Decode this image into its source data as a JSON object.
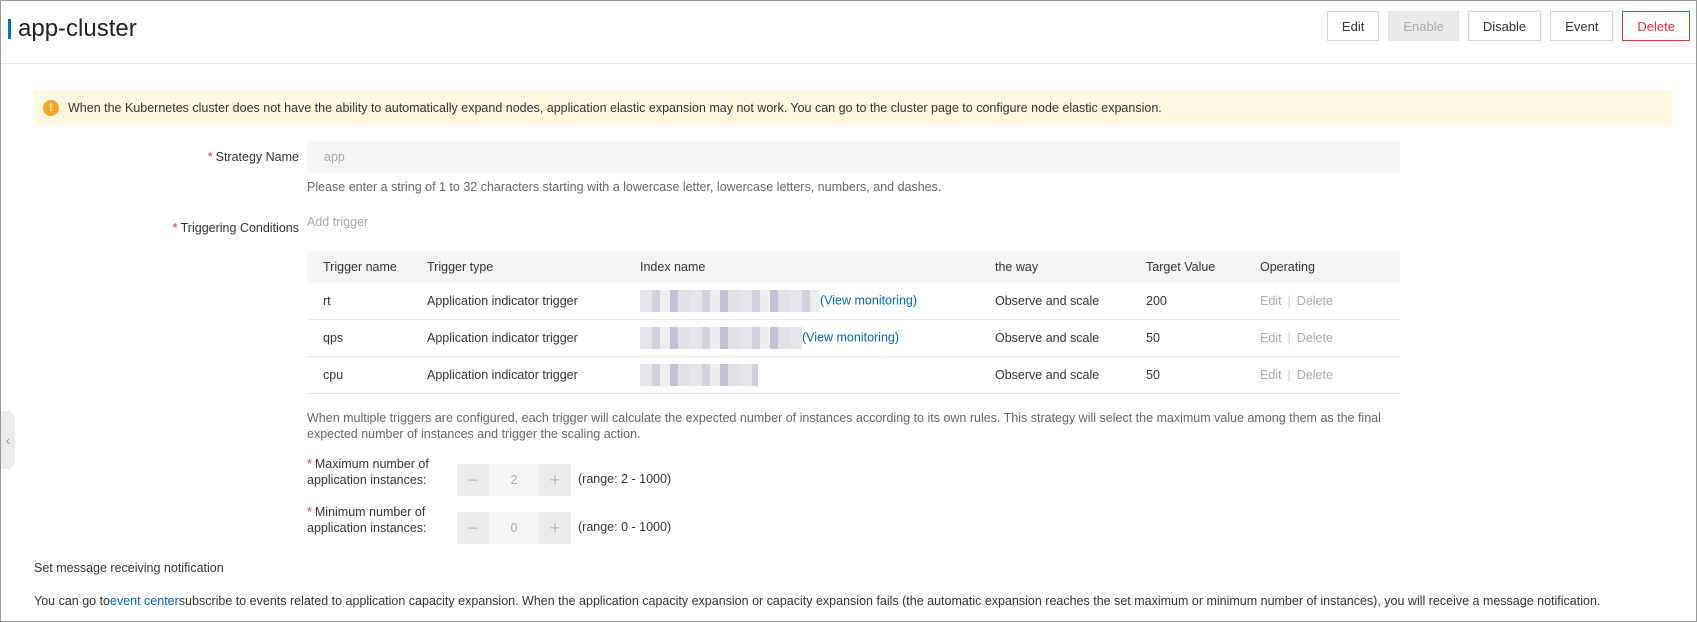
{
  "header": {
    "title": "app-cluster",
    "buttons": {
      "edit": "Edit",
      "enable": "Enable",
      "disable": "Disable",
      "event": "Event",
      "delete": "Delete"
    }
  },
  "alert": {
    "icon": "warning-icon",
    "text": "When the Kubernetes cluster does not have the ability to automatically expand nodes, application elastic expansion may not work. You can go to the cluster page to configure node elastic expansion."
  },
  "form": {
    "strategy_name": {
      "label": "Strategy Name",
      "placeholder": "app",
      "hint": "Please enter a string of 1 to 32 characters starting with a lowercase letter, lowercase letters, numbers, and dashes."
    },
    "triggering_conditions": {
      "label": "Triggering Conditions",
      "add_trigger": "Add trigger"
    }
  },
  "trigger_table": {
    "headers": [
      "Trigger name",
      "Trigger type",
      "Index name",
      "the way",
      "Target Value",
      "Operating"
    ],
    "rows": [
      {
        "name": "rt",
        "type": "Application indicator trigger",
        "view_link": "(View monitoring)",
        "way": "Observe and scale",
        "target": "200",
        "edit": "Edit",
        "delete": "Delete"
      },
      {
        "name": "qps",
        "type": "Application indicator trigger",
        "view_link": "(View monitoring)",
        "way": "Observe and scale",
        "target": "50",
        "edit": "Edit",
        "delete": "Delete"
      },
      {
        "name": "cpu",
        "type": "Application indicator trigger",
        "view_link": "",
        "way": "Observe and scale",
        "target": "50",
        "edit": "Edit",
        "delete": "Delete"
      }
    ]
  },
  "multi_trigger_note": "When multiple triggers are configured, each trigger will calculate the expected number of instances according to its own rules. This strategy will select the maximum value among them as the final expected number of instances and trigger the scaling action.",
  "max_instances": {
    "label": "Maximum number of application instances:",
    "value": "2",
    "range": "(range: 2 - 1000)"
  },
  "min_instances": {
    "label": "Minimum number of application instances:",
    "value": "0",
    "range": "(range: 0 - 1000)"
  },
  "notification": {
    "title": "Set message receiving notification",
    "text_before": "You can go to",
    "link": "event center",
    "text_after": "subscribe to events related to application capacity expansion. When the application capacity expansion or capacity expansion fails (the automatic expansion reaches the set maximum or minimum number of instances), you will receive a message notification."
  }
}
